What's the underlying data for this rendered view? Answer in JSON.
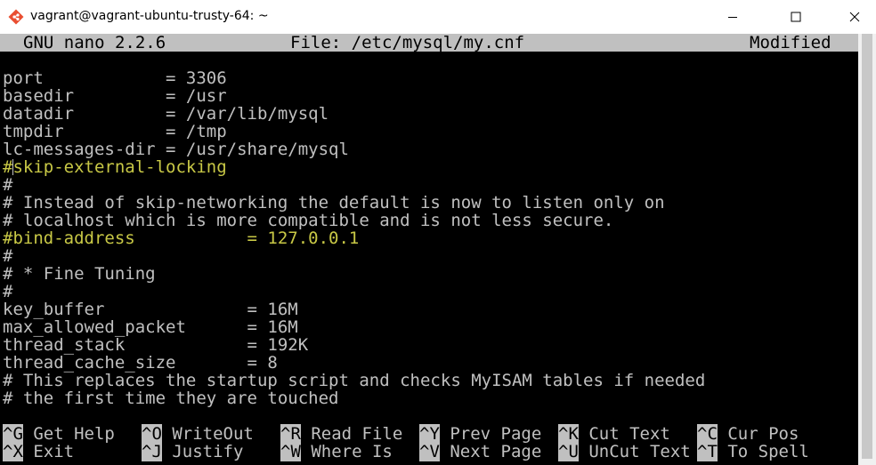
{
  "window": {
    "title": "vagrant@vagrant-ubuntu-trusty-64: ~",
    "app_icon": "git-bash-diamond-icon"
  },
  "nano": {
    "version": "GNU nano 2.2.6",
    "file": "File: /etc/mysql/my.cnf",
    "state": "Modified"
  },
  "lines": [
    "port            = 3306",
    "basedir         = /usr",
    "datadir         = /var/lib/mysql",
    "tmpdir          = /tmp",
    "lc-messages-dir = /usr/share/mysql",
    "#skip-external-locking",
    "#",
    "# Instead of skip-networking the default is now to listen only on",
    "# localhost which is more compatible and is not less secure.",
    "#bind-address           = 127.0.0.1",
    "#",
    "# * Fine Tuning",
    "#",
    "key_buffer              = 16M",
    "max_allowed_packet      = 16M",
    "thread_stack            = 192K",
    "thread_cache_size       = 8",
    "# This replaces the startup script and checks MyISAM tables if needed",
    "# the first time they are touched"
  ],
  "line_colors": {
    "yellow": "#c8c846",
    "default": "#c0c0c0"
  },
  "shortcuts": [
    {
      "key": "^G",
      "label": " Get Help"
    },
    {
      "key": "^O",
      "label": " WriteOut"
    },
    {
      "key": "^R",
      "label": " Read File"
    },
    {
      "key": "^Y",
      "label": " Prev Page"
    },
    {
      "key": "^K",
      "label": " Cut Text"
    },
    {
      "key": "^C",
      "label": " Cur Pos"
    },
    {
      "key": "^X",
      "label": " Exit"
    },
    {
      "key": "^J",
      "label": " Justify"
    },
    {
      "key": "^W",
      "label": " Where Is"
    },
    {
      "key": "^V",
      "label": " Next Page"
    },
    {
      "key": "^U",
      "label": " UnCut Text"
    },
    {
      "key": "^T",
      "label": " To Spell"
    }
  ]
}
